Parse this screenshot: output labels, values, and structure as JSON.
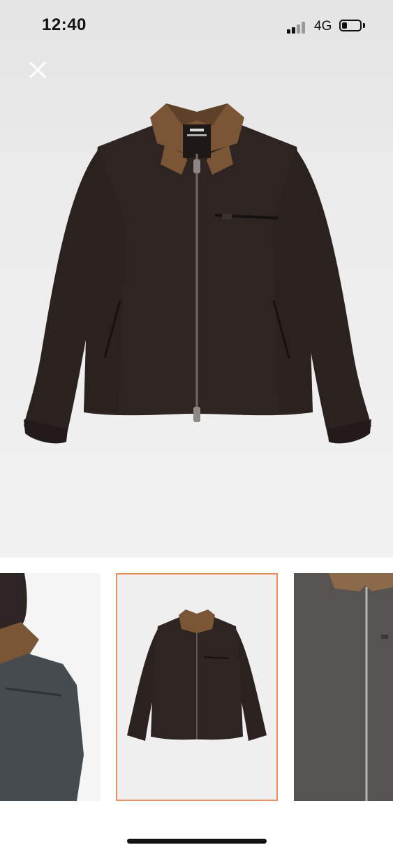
{
  "status_bar": {
    "time": "12:40",
    "network": "4G"
  },
  "icons": {
    "close": "close-icon",
    "signal": "cellular-signal-icon",
    "battery": "battery-icon"
  },
  "gallery": {
    "selected_index": 1,
    "thumbnail_count": 3,
    "selected_border_color": "#e8935e"
  },
  "colors": {
    "jacket": "#2a211f",
    "collar": "#7a5636"
  }
}
